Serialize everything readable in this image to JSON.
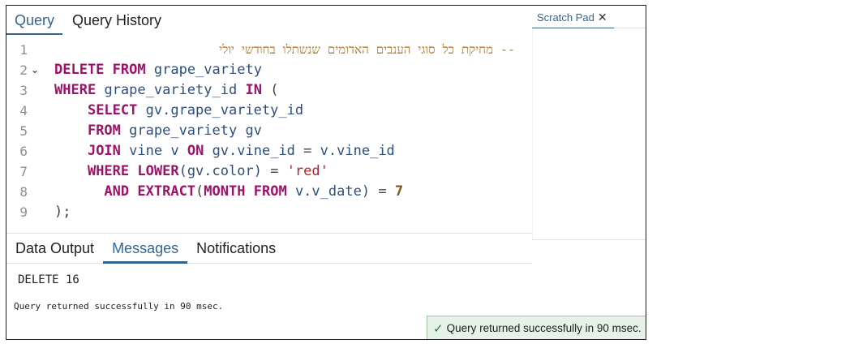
{
  "query_tabs": [
    {
      "label": "Query",
      "active": true
    },
    {
      "label": "Query History",
      "active": false
    }
  ],
  "scratch_pad": {
    "label": "Scratch Pad",
    "close_icon": "close-icon"
  },
  "editor": {
    "line_numbers": [
      "1",
      "2",
      "3",
      "4",
      "5",
      "6",
      "7",
      "8",
      "9"
    ],
    "comment": "-- מחיקת כל סוגי הענבים האדומים שנשתלו בחודשי יולי",
    "tokens": {
      "delete": "DELETE",
      "from": "FROM",
      "grape_variety": "grape_variety",
      "where": "WHERE",
      "grape_variety_id": "grape_variety_id",
      "in": "IN",
      "open_paren": "(",
      "select": "SELECT",
      "gv_grape_variety_id": "gv.grape_variety_id",
      "from_table": "grape_variety gv",
      "join": "JOIN",
      "vine_v": "vine v",
      "on": "ON",
      "join_cond_left": "gv.vine_id",
      "eq": "=",
      "join_cond_right": "v.vine_id",
      "lower": "LOWER",
      "lower_arg": "(gv.color)",
      "red": "'red'",
      "and": "AND",
      "extract": "EXTRACT",
      "month": "MONTH",
      "v_date": "v.v_date)",
      "seven": "7",
      "close": ");"
    }
  },
  "result_tabs": [
    {
      "label": "Data Output",
      "active": false
    },
    {
      "label": "Messages",
      "active": true
    },
    {
      "label": "Notifications",
      "active": false
    }
  ],
  "messages": {
    "result_code": "DELETE 16",
    "status_text": "Query returned successfully in 90 msec."
  },
  "toast": {
    "icon": "check-icon",
    "text": "Query returned successfully in 90 msec.",
    "color": "#e6f2e8"
  }
}
